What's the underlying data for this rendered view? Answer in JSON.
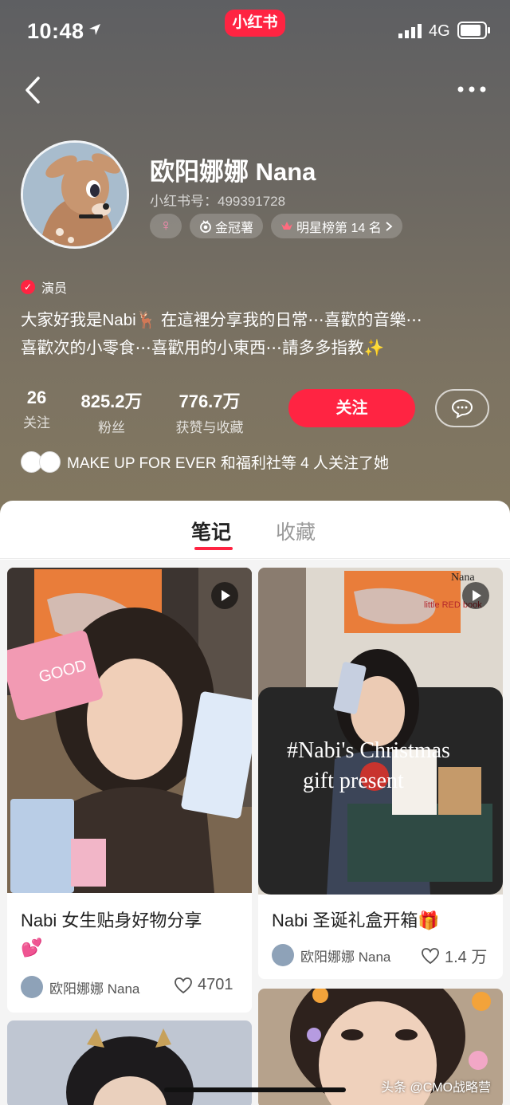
{
  "status_bar": {
    "time": "10:48",
    "app_badge": "小红书",
    "network": "4G"
  },
  "profile": {
    "name": "欧阳娜娜 Nana",
    "red_id": "小红书号：499391728",
    "tags": {
      "crown": "金冠薯",
      "rank": "明星榜第 14 名"
    },
    "verified_label": "演员",
    "bio_line1": "大家好我是Nabi🦌 在這裡分享我的日常⋯喜歡的音樂⋯",
    "bio_line2": "喜歡次的小零食⋯喜歡用的小東西⋯請多多指教✨",
    "stats": {
      "following": {
        "value": "26",
        "label": "关注"
      },
      "fans": {
        "value": "825.2万",
        "label": "粉丝"
      },
      "likes": {
        "value": "776.7万",
        "label": "获赞与收藏"
      }
    },
    "follow_button": "关注",
    "mutual_text": "MAKE UP FOR EVER 和福利社等 4 人关注了她",
    "mutual_logos": [
      "MAKE UP FOR EVER",
      "福利社"
    ]
  },
  "tabs": [
    {
      "label": "笔记",
      "active": true
    },
    {
      "label": "收藏",
      "active": false
    }
  ],
  "notes": [
    {
      "title_line1": "Nabi 女生贴身好物分享",
      "title_line2": "💕",
      "author": "欧阳娜娜 Nana",
      "likes": "4701",
      "has_video": true
    },
    {
      "title": "Nabi 圣诞礼盒开箱🎁",
      "author": "欧阳娜娜 Nana",
      "likes": "1.4 万",
      "has_video": true,
      "overlay_line1": "#Nabi's Christmas",
      "overlay_line2": "gift  present",
      "sticker_text_1": "Nana",
      "sticker_text_2": "little RED book"
    }
  ],
  "watermark": "头条 @CMO战略营",
  "colors": {
    "accent": "#ff2442"
  }
}
